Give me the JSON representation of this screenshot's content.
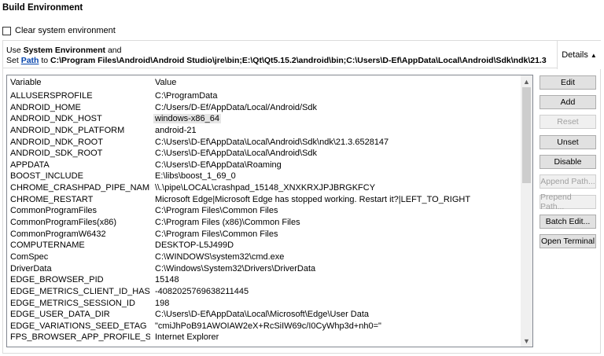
{
  "title": "Build Environment",
  "clear_label": "Clear system environment",
  "summary": {
    "line1_pre": "Use ",
    "line1_bold": "System Environment",
    "line1_post": " and",
    "line2_pre": "Set ",
    "line2_link": "Path",
    "line2_mid": " to ",
    "line2_bold": "C:\\Program Files\\Android\\Android Studio\\jre\\bin;E:\\Qt\\Qt5.15.2\\android\\bin;C:\\Users\\D-Ef\\AppData\\Local\\Android\\Sdk\\ndk\\21.3"
  },
  "details_label": "Details",
  "table": {
    "headers": [
      "Variable",
      "Value"
    ],
    "rows": [
      [
        "ALLUSERSPROFILE",
        "C:\\ProgramData"
      ],
      [
        "ANDROID_HOME",
        "C:/Users/D-Ef/AppData/Local/Android/Sdk"
      ],
      [
        "ANDROID_NDK_HOST",
        "windows-x86_64"
      ],
      [
        "ANDROID_NDK_PLATFORM",
        "android-21"
      ],
      [
        "ANDROID_NDK_ROOT",
        "C:\\Users\\D-Ef\\AppData\\Local\\Android\\Sdk\\ndk\\21.3.6528147"
      ],
      [
        "ANDROID_SDK_ROOT",
        "C:\\Users\\D-Ef\\AppData\\Local\\Android\\Sdk"
      ],
      [
        "APPDATA",
        "C:\\Users\\D-Ef\\AppData\\Roaming"
      ],
      [
        "BOOST_INCLUDE",
        "E:\\libs\\boost_1_69_0"
      ],
      [
        "CHROME_CRASHPAD_PIPE_NAME",
        "\\\\.\\pipe\\LOCAL\\crashpad_15148_XNXKRXJPJBRGKFCY"
      ],
      [
        "CHROME_RESTART",
        "Microsoft Edge|Microsoft Edge has stopped working. Restart it?|LEFT_TO_RIGHT"
      ],
      [
        "CommonProgramFiles",
        "C:\\Program Files\\Common Files"
      ],
      [
        "CommonProgramFiles(x86)",
        "C:\\Program Files (x86)\\Common Files"
      ],
      [
        "CommonProgramW6432",
        "C:\\Program Files\\Common Files"
      ],
      [
        "COMPUTERNAME",
        "DESKTOP-L5J499D"
      ],
      [
        "ComSpec",
        "C:\\WINDOWS\\system32\\cmd.exe"
      ],
      [
        "DriverData",
        "C:\\Windows\\System32\\Drivers\\DriverData"
      ],
      [
        "EDGE_BROWSER_PID",
        "15148"
      ],
      [
        "EDGE_METRICS_CLIENT_ID_HASH",
        "-4082025769638211445"
      ],
      [
        "EDGE_METRICS_SESSION_ID",
        "198"
      ],
      [
        "EDGE_USER_DATA_DIR",
        "C:\\Users\\D-Ef\\AppData\\Local\\Microsoft\\Edge\\User Data"
      ],
      [
        "EDGE_VARIATIONS_SEED_ETAG",
        "\"cmiJhPoB91AWOIAW2eX+RcSiIW69c/I0CyWhp3d+nh0=\""
      ],
      [
        "FPS_BROWSER_APP_PROFILE_STRING",
        "Internet Explorer"
      ]
    ]
  },
  "buttons": [
    {
      "label": "Edit",
      "enabled": true
    },
    {
      "label": "Add",
      "enabled": true
    },
    {
      "label": "Reset",
      "enabled": false
    },
    {
      "label": "Unset",
      "enabled": true
    },
    {
      "label": "Disable",
      "enabled": true
    },
    {
      "label": "Append Path...",
      "enabled": false
    },
    {
      "label": "Prepend Path...",
      "enabled": false
    },
    {
      "label": "Batch Edit...",
      "enabled": true
    },
    {
      "label": "Open Terminal",
      "enabled": true
    }
  ]
}
